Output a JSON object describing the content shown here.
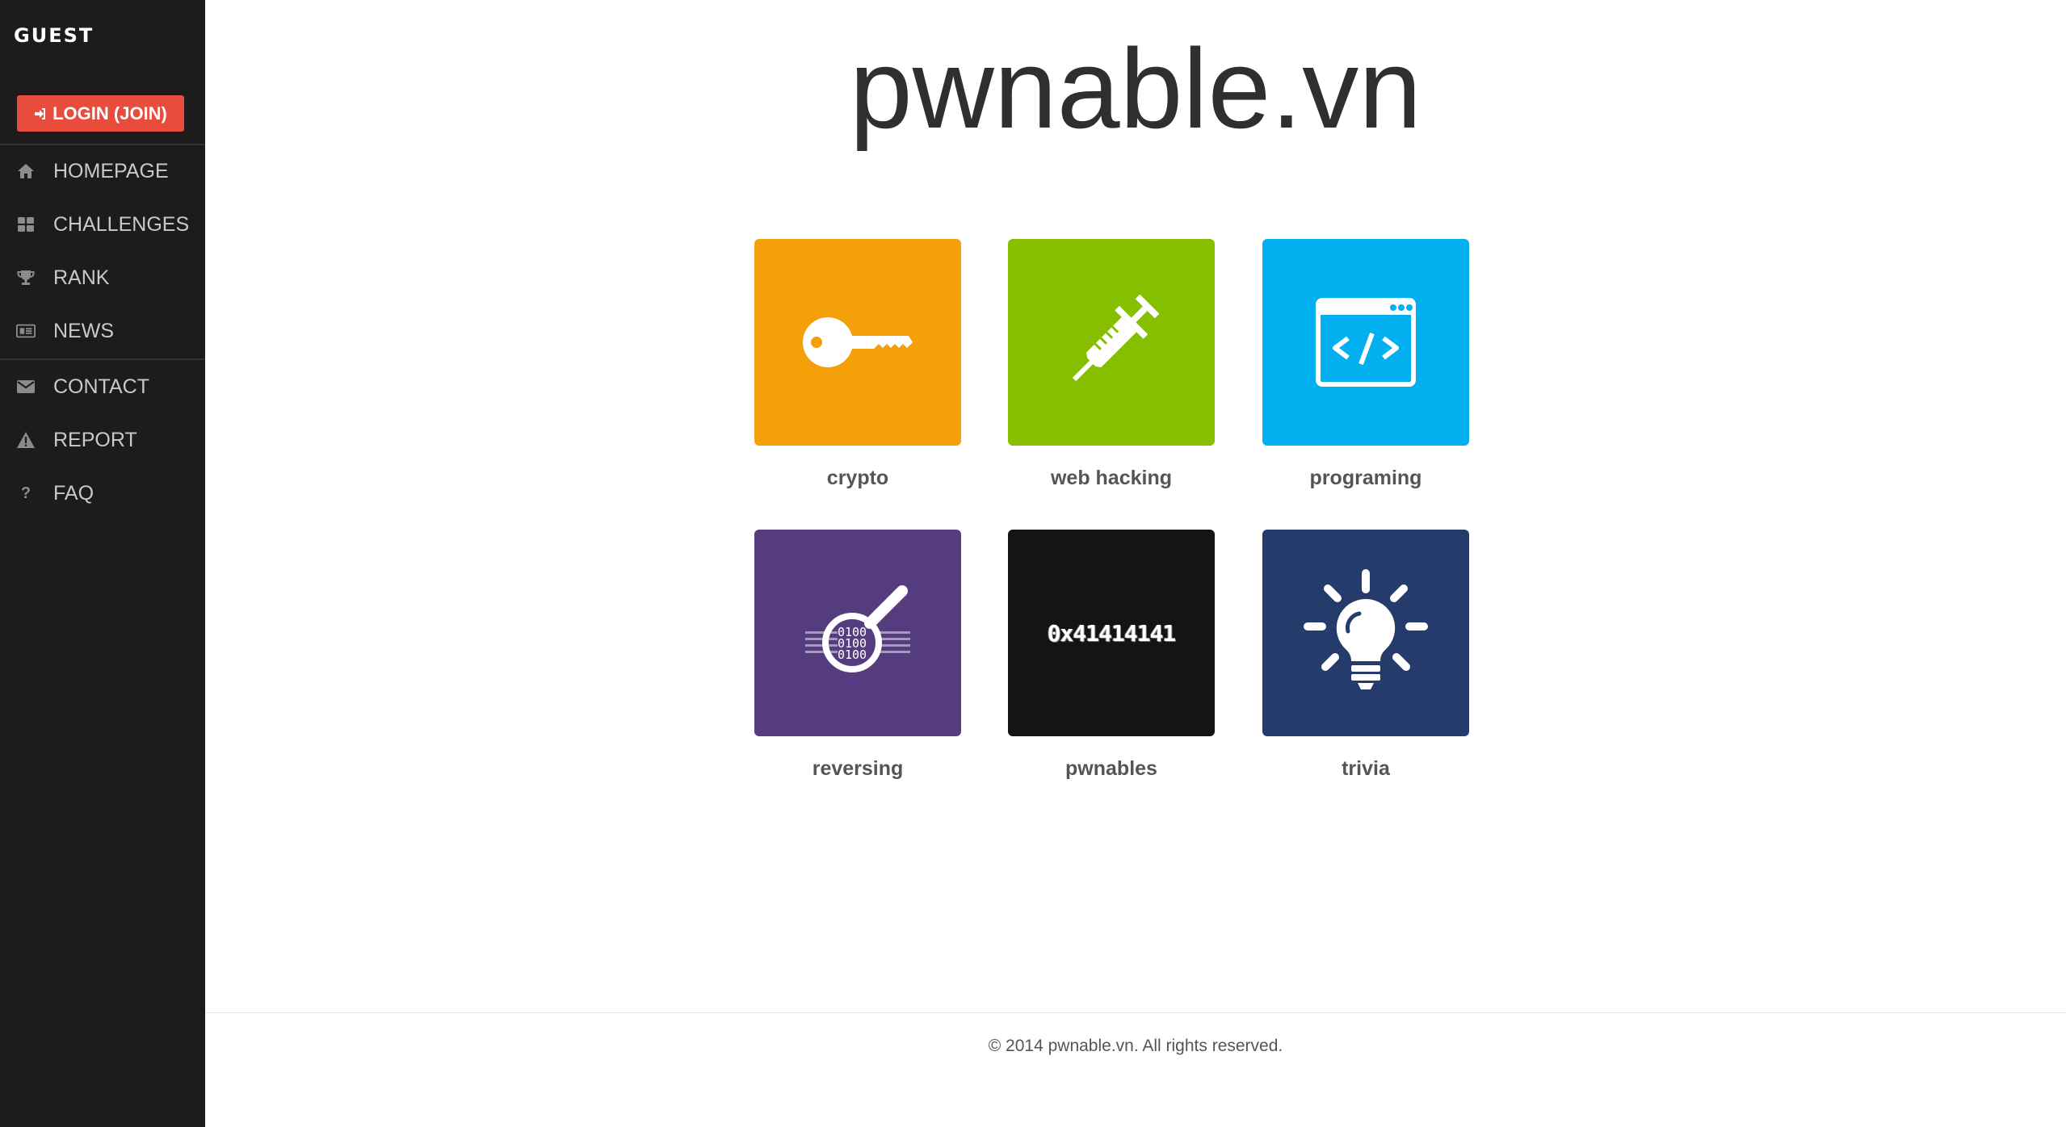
{
  "sidebar": {
    "user": "GUEST",
    "login_label": "LOGIN (JOIN)",
    "items": [
      {
        "label": "HOMEPAGE",
        "icon": "home-icon"
      },
      {
        "label": "CHALLENGES",
        "icon": "grid-icon"
      },
      {
        "label": "RANK",
        "icon": "trophy-icon"
      },
      {
        "label": "NEWS",
        "icon": "newspaper-icon"
      },
      {
        "label": "CONTACT",
        "icon": "envelope-icon"
      },
      {
        "label": "REPORT",
        "icon": "warning-icon"
      },
      {
        "label": "FAQ",
        "icon": "question-icon"
      }
    ],
    "background": "#1c1c1c",
    "login_color": "#e74c3c"
  },
  "main": {
    "title": "pwnable.vn",
    "categories": [
      {
        "label": "crypto",
        "icon": "key-icon",
        "color": "#f5a009"
      },
      {
        "label": "web hacking",
        "icon": "syringe-icon",
        "color": "#85bf00"
      },
      {
        "label": "programing",
        "icon": "code-window-icon",
        "color": "#02b0ef"
      },
      {
        "label": "reversing",
        "icon": "magnifier-binary-icon",
        "color": "#553c7e",
        "icon_text": "0100"
      },
      {
        "label": "pwnables",
        "icon": "hex-text-icon",
        "color": "#141414",
        "icon_text": "0x41414141"
      },
      {
        "label": "trivia",
        "icon": "lightbulb-icon",
        "color": "#243b6b"
      }
    ]
  },
  "footer": {
    "text": "© 2014 pwnable.vn. All rights reserved."
  }
}
